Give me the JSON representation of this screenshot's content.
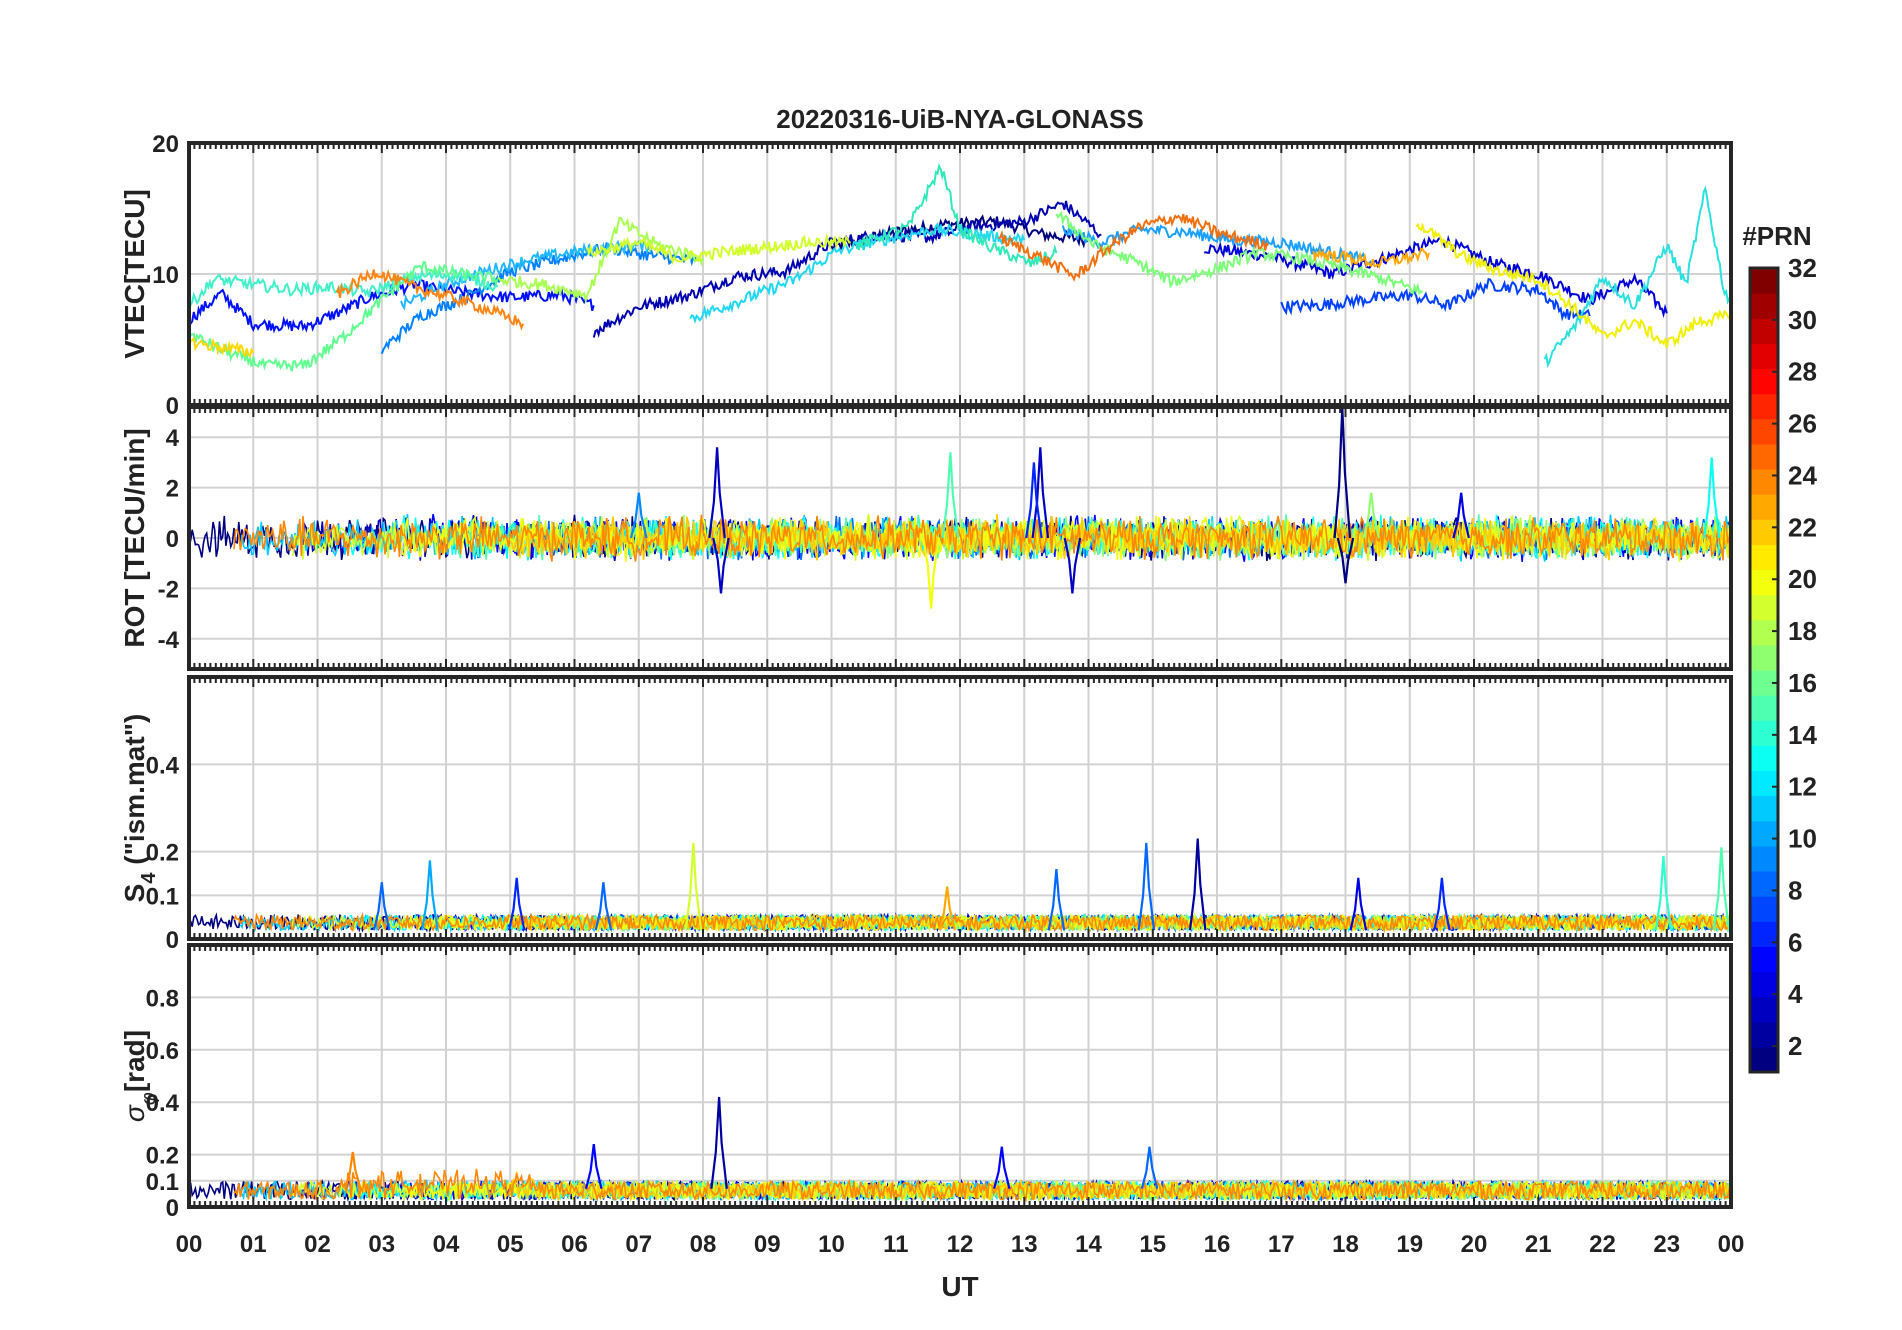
{
  "title": "20220316-UiB-NYA-GLONASS",
  "xlabel": "UT",
  "x_tick_labels": [
    "00",
    "01",
    "02",
    "03",
    "04",
    "05",
    "06",
    "07",
    "08",
    "09",
    "10",
    "11",
    "12",
    "13",
    "14",
    "15",
    "16",
    "17",
    "18",
    "19",
    "20",
    "21",
    "22",
    "23",
    "00"
  ],
  "colorbar": {
    "title": "#PRN",
    "colormap": "jet",
    "range": [
      1,
      32
    ],
    "tick_labels": [
      "2",
      "4",
      "6",
      "8",
      "10",
      "12",
      "14",
      "16",
      "18",
      "20",
      "22",
      "24",
      "26",
      "28",
      "30",
      "32"
    ]
  },
  "chart_data": [
    {
      "type": "line",
      "ylabel": "VTEC[TECU]",
      "ylim": [
        0,
        20
      ],
      "y_tick_labels": [
        "0",
        "10",
        "20"
      ],
      "xlim": [
        0,
        24
      ],
      "grid": true,
      "series": [
        {
          "prn": 1,
          "color": "#00007f",
          "points": [
            [
              10.0,
              12.0
            ],
            [
              11.0,
              13.2
            ],
            [
              11.8,
              13.8
            ],
            [
              12.6,
              14.0
            ],
            [
              13.3,
              13.0
            ],
            [
              14.0,
              12.6
            ]
          ]
        },
        {
          "prn": 3,
          "color": "#0000d8",
          "points": [
            [
              15.8,
              12.0
            ],
            [
              16.8,
              11.4
            ],
            [
              17.8,
              10.0
            ],
            [
              18.8,
              11.5
            ],
            [
              19.5,
              12.6
            ],
            [
              20.3,
              10.8
            ],
            [
              21.0,
              10.0
            ],
            [
              21.8,
              8.0
            ],
            [
              22.5,
              9.6
            ],
            [
              23.0,
              7.0
            ]
          ]
        },
        {
          "prn": 4,
          "color": "#0010ff",
          "points": [
            [
              0.0,
              6.5
            ],
            [
              0.5,
              8.5
            ],
            [
              1.0,
              6.2
            ],
            [
              1.8,
              6.0
            ],
            [
              2.3,
              7.0
            ],
            [
              2.8,
              8.2
            ],
            [
              3.5,
              9.2
            ],
            [
              4.2,
              8.6
            ],
            [
              5.0,
              8.2
            ],
            [
              5.8,
              8.4
            ],
            [
              6.3,
              7.6
            ]
          ]
        },
        {
          "prn": 5,
          "color": "#0000b0",
          "points": [
            [
              6.3,
              5.6
            ],
            [
              7.0,
              7.5
            ],
            [
              7.8,
              8.4
            ],
            [
              8.5,
              9.8
            ],
            [
              9.3,
              10.2
            ],
            [
              10.0,
              12.4
            ],
            [
              10.8,
              13.0
            ],
            [
              11.5,
              12.8
            ],
            [
              12.2,
              13.6
            ],
            [
              13.0,
              14.0
            ],
            [
              13.6,
              15.4
            ],
            [
              14.2,
              13.0
            ]
          ]
        },
        {
          "prn": 6,
          "color": "#0040ff",
          "points": [
            [
              17.0,
              7.5
            ],
            [
              17.6,
              7.6
            ],
            [
              18.2,
              8.0
            ],
            [
              19.0,
              8.4
            ],
            [
              19.6,
              7.6
            ],
            [
              20.2,
              9.2
            ],
            [
              21.0,
              8.8
            ],
            [
              21.4,
              7.0
            ],
            [
              21.8,
              6.8
            ]
          ]
        },
        {
          "prn": 8,
          "color": "#0080ff",
          "points": [
            [
              3.0,
              4.2
            ],
            [
              3.6,
              6.8
            ],
            [
              4.3,
              8.2
            ],
            [
              5.0,
              10.2
            ],
            [
              5.8,
              11.2
            ],
            [
              6.5,
              12.0
            ],
            [
              7.2,
              11.4
            ],
            [
              7.9,
              11.0
            ]
          ]
        },
        {
          "prn": 9,
          "color": "#1aa0ff",
          "points": [
            [
              13.6,
              13.4
            ],
            [
              14.2,
              12.4
            ],
            [
              14.8,
              13.4
            ],
            [
              15.5,
              13.2
            ],
            [
              16.2,
              12.6
            ],
            [
              17.0,
              12.4
            ],
            [
              17.8,
              11.6
            ],
            [
              18.4,
              11.0
            ]
          ]
        },
        {
          "prn": 10,
          "color": "#20b8ff",
          "points": [
            [
              3.3,
              7.6
            ],
            [
              4.0,
              9.2
            ],
            [
              4.6,
              10.2
            ],
            [
              5.2,
              11.0
            ],
            [
              5.9,
              11.6
            ],
            [
              6.5,
              12.0
            ],
            [
              7.2,
              12.2
            ]
          ]
        },
        {
          "prn": 11,
          "color": "#20d8f0",
          "points": [
            [
              7.8,
              6.6
            ],
            [
              8.6,
              8.0
            ],
            [
              9.4,
              9.5
            ],
            [
              10.1,
              11.8
            ],
            [
              10.8,
              12.6
            ],
            [
              11.6,
              13.4
            ],
            [
              12.3,
              13.0
            ],
            [
              13.0,
              12.6
            ]
          ]
        },
        {
          "prn": 12,
          "color": "#2ae0e0",
          "points": [
            [
              21.1,
              3.2
            ],
            [
              21.6,
              6.2
            ],
            [
              22.0,
              9.8
            ],
            [
              22.5,
              7.6
            ],
            [
              23.0,
              12.2
            ],
            [
              23.3,
              9.2
            ],
            [
              23.6,
              16.4
            ],
            [
              23.9,
              8.6
            ],
            [
              24.0,
              8.0
            ]
          ]
        },
        {
          "prn": 13,
          "color": "#40f0c8",
          "points": [
            [
              0.0,
              7.6
            ],
            [
              0.4,
              9.6
            ],
            [
              1.0,
              9.2
            ],
            [
              1.6,
              8.8
            ],
            [
              2.2,
              9.0
            ],
            [
              2.8,
              8.6
            ],
            [
              3.5,
              9.8
            ],
            [
              4.2,
              10.0
            ],
            [
              4.8,
              9.0
            ]
          ]
        },
        {
          "prn": 14,
          "color": "#30e8b8",
          "points": [
            [
              10.4,
              12.2
            ],
            [
              11.2,
              13.6
            ],
            [
              11.7,
              18.2
            ],
            [
              12.0,
              13.4
            ],
            [
              12.5,
              12.0
            ],
            [
              13.1,
              10.8
            ],
            [
              13.5,
              11.6
            ]
          ]
        },
        {
          "prn": 15,
          "color": "#60ff90",
          "points": [
            [
              0.0,
              5.4
            ],
            [
              0.6,
              4.0
            ],
            [
              1.2,
              3.0
            ],
            [
              1.8,
              3.0
            ],
            [
              2.4,
              5.2
            ],
            [
              3.0,
              8.0
            ],
            [
              3.6,
              10.6
            ],
            [
              4.2,
              10.0
            ],
            [
              4.8,
              9.6
            ]
          ]
        },
        {
          "prn": 16,
          "color": "#7cff78",
          "points": [
            [
              13.5,
              14.6
            ],
            [
              14.1,
              12.2
            ],
            [
              14.7,
              11.0
            ],
            [
              15.3,
              9.4
            ],
            [
              16.0,
              10.4
            ],
            [
              16.6,
              11.6
            ],
            [
              17.3,
              11.2
            ],
            [
              18.0,
              10.4
            ],
            [
              18.6,
              9.6
            ],
            [
              19.2,
              8.6
            ]
          ]
        },
        {
          "prn": 17,
          "color": "#a8ff50",
          "points": [
            [
              4.8,
              9.6
            ],
            [
              5.5,
              9.2
            ],
            [
              6.2,
              8.4
            ],
            [
              6.7,
              14.0
            ],
            [
              7.3,
              12.2
            ],
            [
              8.0,
              11.2
            ]
          ]
        },
        {
          "prn": 18,
          "color": "#d2ff2a",
          "points": [
            [
              6.2,
              11.6
            ],
            [
              7.0,
              12.4
            ],
            [
              7.6,
              11.2
            ],
            [
              8.2,
              11.6
            ],
            [
              8.9,
              12.0
            ],
            [
              9.6,
              12.4
            ],
            [
              10.3,
              12.4
            ]
          ]
        },
        {
          "prn": 19,
          "color": "#f0f000",
          "points": [
            [
              19.1,
              14.0
            ],
            [
              19.8,
              11.4
            ],
            [
              20.4,
              10.2
            ],
            [
              21.0,
              9.6
            ],
            [
              21.6,
              7.2
            ],
            [
              22.0,
              5.2
            ],
            [
              22.5,
              6.4
            ],
            [
              23.0,
              4.6
            ],
            [
              23.5,
              6.4
            ],
            [
              24.0,
              6.8
            ]
          ]
        },
        {
          "prn": 20,
          "color": "#ffd800",
          "points": [
            [
              0.0,
              4.8
            ],
            [
              0.5,
              4.4
            ],
            [
              1.0,
              4.0
            ]
          ]
        },
        {
          "prn": 22,
          "color": "#ffa800",
          "points": [
            [
              17.5,
              11.6
            ],
            [
              18.1,
              11.2
            ],
            [
              18.5,
              10.8
            ],
            [
              19.3,
              11.6
            ]
          ]
        },
        {
          "prn": 24,
          "color": "#ff8410",
          "points": [
            [
              2.3,
              8.4
            ],
            [
              2.9,
              10.2
            ],
            [
              3.5,
              9.0
            ],
            [
              4.1,
              8.2
            ],
            [
              4.7,
              7.2
            ],
            [
              5.2,
              6.2
            ]
          ]
        },
        {
          "prn": 25,
          "color": "#f07010",
          "points": [
            [
              12.6,
              12.8
            ],
            [
              13.2,
              11.4
            ],
            [
              13.8,
              9.8
            ],
            [
              14.3,
              12.0
            ],
            [
              14.8,
              13.6
            ],
            [
              15.4,
              14.4
            ],
            [
              16.1,
              13.0
            ],
            [
              16.8,
              12.2
            ]
          ]
        }
      ]
    },
    {
      "type": "line",
      "ylabel": "ROT [TECU/min]",
      "ylim": [
        -5.2,
        5.2
      ],
      "y_tick_labels": [
        "4",
        "2",
        "0",
        "-2",
        "-4"
      ],
      "xlim": [
        0,
        24
      ],
      "grid": true,
      "spikes": [
        {
          "x": 8.22,
          "y": 3.6,
          "prn": 3
        },
        {
          "x": 8.28,
          "y": -2.2,
          "prn": 3
        },
        {
          "x": 11.85,
          "y": 3.4,
          "prn": 15
        },
        {
          "x": 11.55,
          "y": -2.8,
          "prn": 20
        },
        {
          "x": 13.25,
          "y": 3.6,
          "prn": 3
        },
        {
          "x": 13.15,
          "y": 3.0,
          "prn": 6
        },
        {
          "x": 13.75,
          "y": -2.2,
          "prn": 3
        },
        {
          "x": 17.95,
          "y": 5.2,
          "prn": 1
        },
        {
          "x": 18.0,
          "y": -1.8,
          "prn": 1
        },
        {
          "x": 18.4,
          "y": 1.8,
          "prn": 17
        },
        {
          "x": 23.7,
          "y": 3.2,
          "prn": 13
        },
        {
          "x": 7.0,
          "y": 1.8,
          "prn": 9
        },
        {
          "x": 19.8,
          "y": 1.8,
          "prn": 4
        }
      ],
      "noise_level": 0.6
    },
    {
      "type": "line",
      "ylabel": "S4 (\"ism.mat\")",
      "ylabel_main": "S",
      "ylabel_subscript": "4",
      "ylabel_rest": " (\"ism.mat\")",
      "ylim": [
        0,
        0.6
      ],
      "y_tick_labels": [
        "0.4",
        "0.2",
        "0.1",
        "0"
      ],
      "xlim": [
        0,
        24
      ],
      "grid": true,
      "spikes": [
        {
          "x": 3.75,
          "y": 0.18,
          "prn": 10
        },
        {
          "x": 3.0,
          "y": 0.13,
          "prn": 8
        },
        {
          "x": 5.1,
          "y": 0.14,
          "prn": 6
        },
        {
          "x": 6.45,
          "y": 0.13,
          "prn": 8
        },
        {
          "x": 7.85,
          "y": 0.22,
          "prn": 19
        },
        {
          "x": 11.8,
          "y": 0.12,
          "prn": 23
        },
        {
          "x": 13.5,
          "y": 0.16,
          "prn": 8
        },
        {
          "x": 14.9,
          "y": 0.22,
          "prn": 8
        },
        {
          "x": 15.7,
          "y": 0.23,
          "prn": 2
        },
        {
          "x": 18.2,
          "y": 0.14,
          "prn": 4
        },
        {
          "x": 19.5,
          "y": 0.14,
          "prn": 6
        },
        {
          "x": 22.95,
          "y": 0.19,
          "prn": 14
        },
        {
          "x": 23.85,
          "y": 0.21,
          "prn": 15
        }
      ],
      "baseline": 0.02
    },
    {
      "type": "line",
      "ylabel": "σφ [rad]",
      "ylabel_main": "σ",
      "ylabel_subscript": "φ",
      "ylabel_rest": "[rad]",
      "ylim": [
        0,
        1.0
      ],
      "y_tick_labels": [
        "0.8",
        "0.6",
        "0.4",
        "0.2",
        "0.1",
        "0"
      ],
      "xlim": [
        0,
        24
      ],
      "grid": true,
      "spikes": [
        {
          "x": 8.25,
          "y": 0.42,
          "prn": 2
        },
        {
          "x": 6.3,
          "y": 0.24,
          "prn": 5
        },
        {
          "x": 12.65,
          "y": 0.23,
          "prn": 5
        },
        {
          "x": 14.95,
          "y": 0.23,
          "prn": 8
        },
        {
          "x": 2.55,
          "y": 0.21,
          "prn": 24
        }
      ],
      "baseline": 0.07
    }
  ]
}
